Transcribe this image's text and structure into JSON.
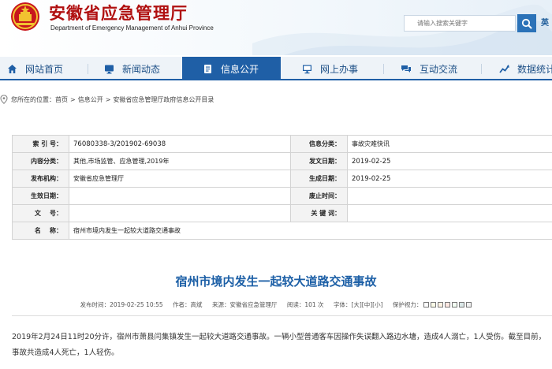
{
  "header": {
    "title": "安徽省应急管理厅",
    "subtitle": "Department of Emergency Management of Anhui Province",
    "search_placeholder": "请输入搜索关键字",
    "edge_tab": "英"
  },
  "nav": {
    "items": [
      {
        "label": "网站首页",
        "icon": "home-icon"
      },
      {
        "label": "新闻动态",
        "icon": "monitor-icon"
      },
      {
        "label": "信息公开",
        "icon": "document-icon",
        "active": true
      },
      {
        "label": "网上办事",
        "icon": "desktop-icon"
      },
      {
        "label": "互动交流",
        "icon": "chat-icon"
      },
      {
        "label": "数据统计",
        "icon": "chart-icon"
      }
    ]
  },
  "breadcrumb": {
    "prefix": "您所在的位置：",
    "items": [
      "首页",
      "信息公开",
      "安徽省应急管理厅政府信息公开目录"
    ],
    "separator": ">"
  },
  "meta": {
    "index_label": "索  引 号：",
    "index_value": "76080338-3/201902-69038",
    "category_label": "信息分类：",
    "category_value": "事故灾难快讯",
    "content_label": "内容分类：",
    "content_value": "其他,市场监管、应急管理,2019年",
    "pubdate_label": "发文日期：",
    "pubdate_value": "2019-02-25",
    "org_label": "发布机构：",
    "org_value": "安徽省应急管理厅",
    "gendate_label": "生成日期：",
    "gendate_value": "2019-02-25",
    "effective_label": "生效日期：",
    "effective_value": "",
    "abolish_label": "废止时间：",
    "abolish_value": "",
    "docno_label": "文    号：",
    "docno_value": "",
    "keywords_label": "关 键 词：",
    "keywords_value": "",
    "name_label": "名    称：",
    "name_value": "宿州市境内发生一起较大道路交通事故"
  },
  "article": {
    "title": "宿州市境内发生一起较大道路交通事故",
    "published": "发布时间：2019-02-25 10:55",
    "author": "作者：高斌",
    "source": "来源：安徽省应急管理厅",
    "views": "阅读：101 次",
    "font_prefix": "字体：",
    "font_large": "[大]",
    "font_medium": "[中]",
    "font_small": "[小]",
    "eye_care": "保护视力：",
    "body": "2019年2月24日11时20分许，宿州市萧县闫集镇发生一起较大道路交通事故。一辆小型普通客车因操作失误翻入路边水塘，造成4人溺亡，1人受伤。截至目前，事故共造成4人死亡，1人轻伤。"
  },
  "colors": {
    "brand_red": "#b01010",
    "nav_blue": "#1f5fa6",
    "title_blue": "#1c5fa6",
    "eye_swatches": [
      "#ffffff",
      "#fafbe6",
      "#fff2e2",
      "#fde6e0",
      "#f3fff3",
      "#dae7e7",
      "#f0f0f0"
    ]
  }
}
